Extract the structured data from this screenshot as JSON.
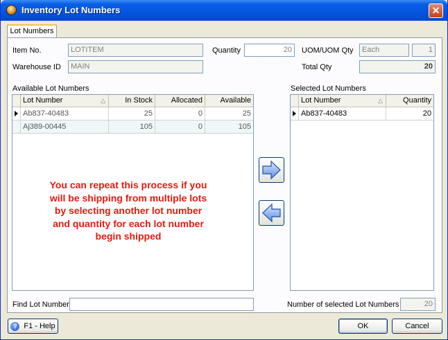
{
  "window": {
    "title": "Inventory Lot Numbers",
    "close_glyph": "✕"
  },
  "tab": {
    "label": "Lot Numbers"
  },
  "form": {
    "item_no_label": "Item No.",
    "item_no_value": "LOTITEM",
    "quantity_label": "Quantity",
    "quantity_value": "20",
    "uom_label": "UOM/UOM Qty",
    "uom_value": "Each",
    "uom_qty_value": "1",
    "warehouse_label": "Warehouse ID",
    "warehouse_value": "MAIN",
    "total_qty_label": "Total Qty",
    "total_qty_value": "20"
  },
  "available": {
    "section_label": "Available Lot Numbers",
    "columns": [
      "Lot Number",
      "In Stock",
      "Allocated",
      "Available"
    ],
    "rows": [
      [
        "Ab837-40483",
        "25",
        "0",
        "25"
      ],
      [
        "Aj389-00445",
        "105",
        "0",
        "105"
      ]
    ]
  },
  "selected": {
    "section_label": "Selected Lot Numbers",
    "columns": [
      "Lot Number",
      "Quantity"
    ],
    "rows": [
      [
        "Ab837-40483",
        "20"
      ]
    ]
  },
  "overlay_lines": [
    "You can repeat this process if you",
    "will be shipping from multiple lots",
    "by selecting another lot number",
    "and quantity for each lot number",
    "begin shipped"
  ],
  "find": {
    "label": "Find Lot Number",
    "value": ""
  },
  "selected_count": {
    "label": "Number of selected Lot Numbers",
    "value": "20"
  },
  "buttons": {
    "help": "F1 - Help",
    "ok": "OK",
    "cancel": "Cancel"
  },
  "colors": {
    "overlay_text": "#e8190e",
    "titlebar": "#0455de"
  }
}
